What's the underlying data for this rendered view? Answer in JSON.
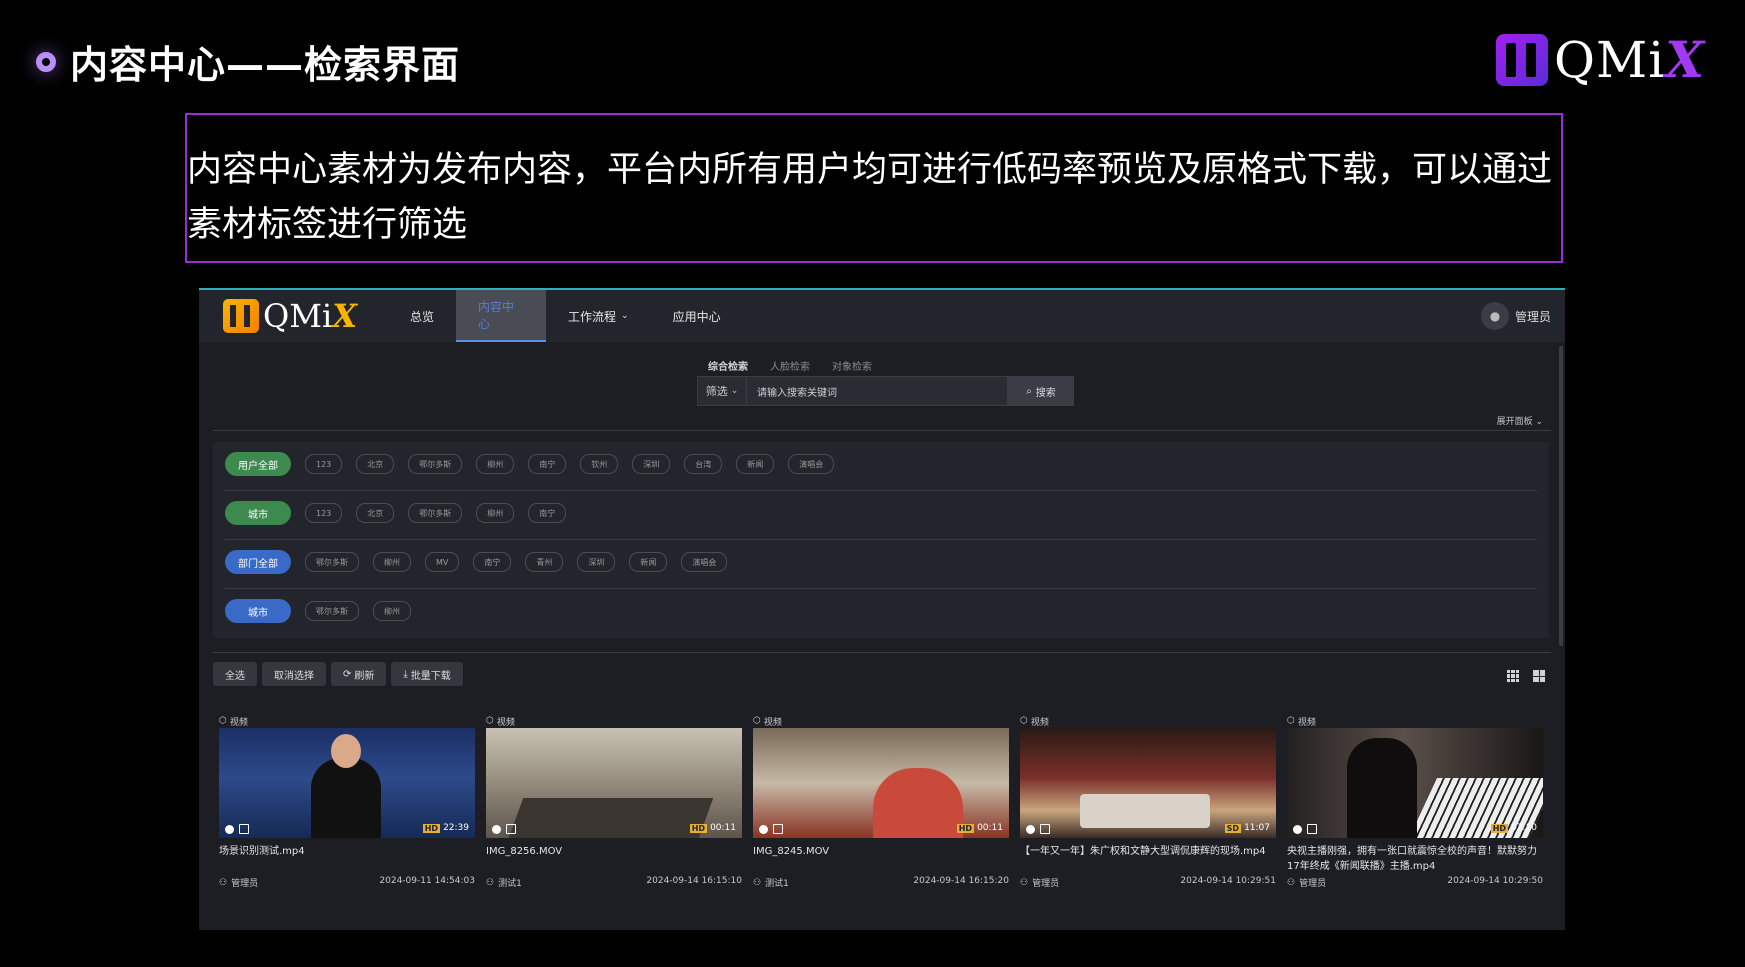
{
  "slide": {
    "title": "内容中心——检索界面",
    "logo_text": "QMi",
    "logo_x": "X",
    "description": "内容中心素材为发布内容，平台内所有用户均可进行低码率预览及原格式下载，可以通过素材标签进行筛选"
  },
  "app": {
    "logo_text": "QMi",
    "logo_x": "X",
    "nav": [
      "总览",
      "内容中心",
      "工作流程",
      "应用中心"
    ],
    "nav_active": "内容中心",
    "user_name": "管理员",
    "search_tabs": [
      "综合检索",
      "人脸检索",
      "对象检索"
    ],
    "filter_label": "筛选",
    "search_placeholder": "请输入搜索关键词",
    "search_button": "搜索",
    "expand_panel": "展开面板",
    "filter_rows": [
      {
        "label": "用户全部",
        "color": "green",
        "chips": [
          "123",
          "北京",
          "鄂尔多斯",
          "柳州",
          "南宁",
          "钦州",
          "深圳",
          "台湾",
          "新闻",
          "演唱会"
        ]
      },
      {
        "label": "城市",
        "color": "green",
        "chips": [
          "123",
          "北京",
          "鄂尔多斯",
          "柳州",
          "南宁"
        ]
      },
      {
        "label": "部门全部",
        "color": "blue",
        "chips": [
          "鄂尔多斯",
          "柳州",
          "MV",
          "南宁",
          "青州",
          "深圳",
          "新闻",
          "演唱会"
        ]
      },
      {
        "label": "城市",
        "color": "blue",
        "chips": [
          "鄂尔多斯",
          "柳州"
        ]
      }
    ],
    "toolbar": {
      "select_all": "全选",
      "deselect": "取消选择",
      "refresh": "刷新",
      "batch_download": "批量下载"
    },
    "cards": [
      {
        "tag": "视频",
        "quality": "HD",
        "duration": "22:39",
        "name": "场景识别测试.mp4",
        "user": "管理员",
        "time": "2024-09-11 14:54:03"
      },
      {
        "tag": "视频",
        "quality": "HD",
        "duration": "00:11",
        "name": "IMG_8256.MOV",
        "user": "测试1",
        "time": "2024-09-14 16:15:10"
      },
      {
        "tag": "视频",
        "quality": "HD",
        "duration": "00:11",
        "name": "IMG_8245.MOV",
        "user": "测试1",
        "time": "2024-09-14 16:15:20"
      },
      {
        "tag": "视频",
        "quality": "SD",
        "duration": "11:07",
        "name": "【一年又一年】朱广权和文静大型调侃康辉的现场.mp4",
        "user": "管理员",
        "time": "2024-09-14 10:29:51"
      },
      {
        "tag": "视频",
        "quality": "HD",
        "duration": "07:10",
        "name": "央视主播刚强，拥有一张口就震惊全校的声音！默默努力17年终成《新闻联播》主播.mp4",
        "user": "管理员",
        "time": "2024-09-14 10:29:50"
      }
    ]
  }
}
